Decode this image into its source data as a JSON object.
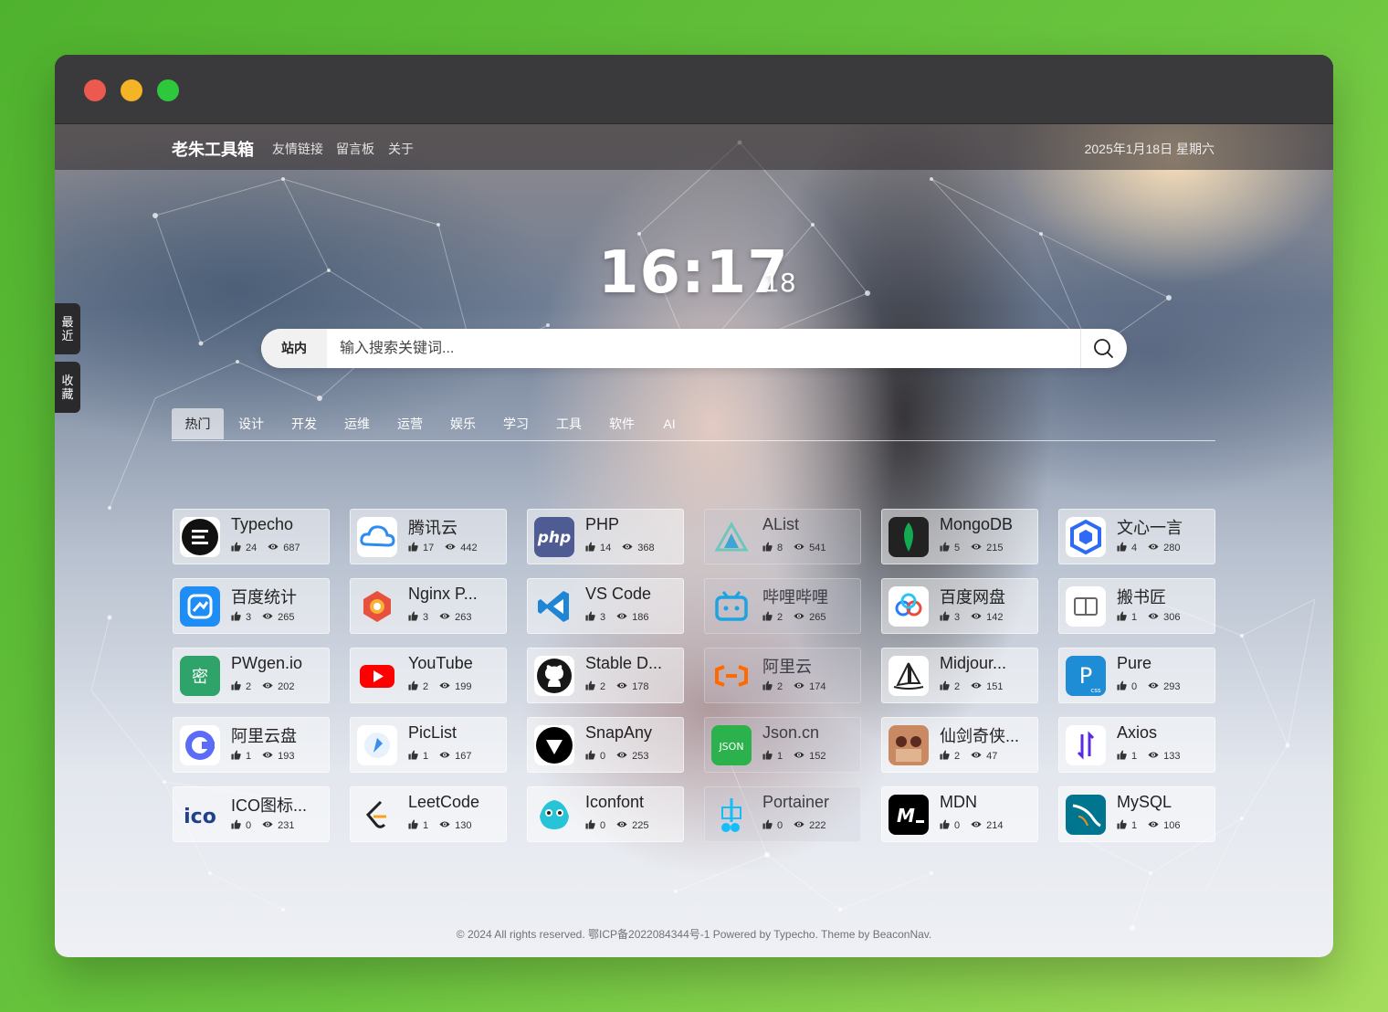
{
  "window": {
    "controls": [
      "close",
      "minimize",
      "maximize"
    ]
  },
  "nav": {
    "brand": "老朱工具箱",
    "links": [
      "友情链接",
      "留言板",
      "关于"
    ],
    "date": "2025年1月18日 星期六"
  },
  "clock": {
    "time": "16:17",
    "seconds": "18"
  },
  "search": {
    "scope": "站内",
    "placeholder": "输入搜索关键词...",
    "button_icon": "search-icon"
  },
  "side_tabs": [
    "最近",
    "收藏"
  ],
  "tabs": [
    "热门",
    "设计",
    "开发",
    "运维",
    "运营",
    "娱乐",
    "学习",
    "工具",
    "软件",
    "AI"
  ],
  "active_tab": "热门",
  "cards": [
    {
      "name": "Typecho",
      "likes": "24",
      "views": "687",
      "icon": "typecho-icon",
      "color": "#111111"
    },
    {
      "name": "腾讯云",
      "likes": "17",
      "views": "442",
      "icon": "tencent-cloud-icon",
      "color": "#2d8cf0"
    },
    {
      "name": "PHP",
      "likes": "14",
      "views": "368",
      "icon": "php-icon",
      "color": "#4f5b93"
    },
    {
      "name": "AList",
      "likes": "8",
      "views": "541",
      "icon": "alist-icon",
      "color": "#70c6be"
    },
    {
      "name": "MongoDB",
      "likes": "5",
      "views": "215",
      "icon": "mongodb-icon",
      "color": "#13aa52"
    },
    {
      "name": "文心一言",
      "likes": "4",
      "views": "280",
      "icon": "wenxin-icon",
      "color": "#2f6af5"
    },
    {
      "name": "百度统计",
      "likes": "3",
      "views": "265",
      "icon": "baidu-tongji-icon",
      "color": "#1e8ef6"
    },
    {
      "name": "Nginx P...",
      "likes": "3",
      "views": "263",
      "icon": "nginx-proxy-icon",
      "color": "#e8513d"
    },
    {
      "name": "VS Code",
      "likes": "3",
      "views": "186",
      "icon": "vscode-icon",
      "color": "#1f86d6"
    },
    {
      "name": "哔哩哔哩",
      "likes": "2",
      "views": "265",
      "icon": "bilibili-icon",
      "color": "#1ea2e2"
    },
    {
      "name": "百度网盘",
      "likes": "3",
      "views": "142",
      "icon": "baidu-pan-icon",
      "color": "#2a7ef5"
    },
    {
      "name": "搬书匠",
      "likes": "1",
      "views": "306",
      "icon": "book-icon",
      "color": "#777777"
    },
    {
      "name": "PWgen.io",
      "likes": "2",
      "views": "202",
      "icon": "pwgen-icon",
      "color": "#2ea36a"
    },
    {
      "name": "YouTube",
      "likes": "2",
      "views": "199",
      "icon": "youtube-icon",
      "color": "#ff0000"
    },
    {
      "name": "Stable D...",
      "likes": "2",
      "views": "178",
      "icon": "github-icon",
      "color": "#181717"
    },
    {
      "name": "阿里云",
      "likes": "2",
      "views": "174",
      "icon": "aliyun-icon",
      "color": "#ff6a00"
    },
    {
      "name": "Midjour...",
      "likes": "2",
      "views": "151",
      "icon": "midjourney-icon",
      "color": "#222222"
    },
    {
      "name": "Pure",
      "likes": "0",
      "views": "293",
      "icon": "purecss-icon",
      "color": "#1f8dd6"
    },
    {
      "name": "阿里云盘",
      "likes": "1",
      "views": "193",
      "icon": "aliyun-pan-icon",
      "color": "#5b6cf9"
    },
    {
      "name": "PicList",
      "likes": "1",
      "views": "167",
      "icon": "piclist-icon",
      "color": "#3a8de8"
    },
    {
      "name": "SnapAny",
      "likes": "0",
      "views": "253",
      "icon": "snapany-icon",
      "color": "#000000"
    },
    {
      "name": "Json.cn",
      "likes": "1",
      "views": "152",
      "icon": "json-icon",
      "color": "#2bb24c"
    },
    {
      "name": "仙剑奇侠...",
      "likes": "2",
      "views": "47",
      "icon": "xianjian-icon",
      "color": "#b05a3c"
    },
    {
      "name": "Axios",
      "likes": "1",
      "views": "133",
      "icon": "axios-icon",
      "color": "#5a29e4"
    },
    {
      "name": "ICO图标...",
      "likes": "0",
      "views": "231",
      "icon": "ico-icon",
      "color": "#1f3f8f"
    },
    {
      "name": "LeetCode",
      "likes": "1",
      "views": "130",
      "icon": "leetcode-icon",
      "color": "#ffa116"
    },
    {
      "name": "Iconfont",
      "likes": "0",
      "views": "225",
      "icon": "iconfont-icon",
      "color": "#27c3d6"
    },
    {
      "name": "Portainer",
      "likes": "0",
      "views": "222",
      "icon": "portainer-icon",
      "color": "#13bef9"
    },
    {
      "name": "MDN",
      "likes": "0",
      "views": "214",
      "icon": "mdn-icon",
      "color": "#000000"
    },
    {
      "name": "MySQL",
      "likes": "1",
      "views": "106",
      "icon": "mysql-icon",
      "color": "#00758f"
    }
  ],
  "footer": "© 2024 All rights reserved. 鄂ICP备2022084344号-1 Powered by Typecho. Theme by BeaconNav."
}
